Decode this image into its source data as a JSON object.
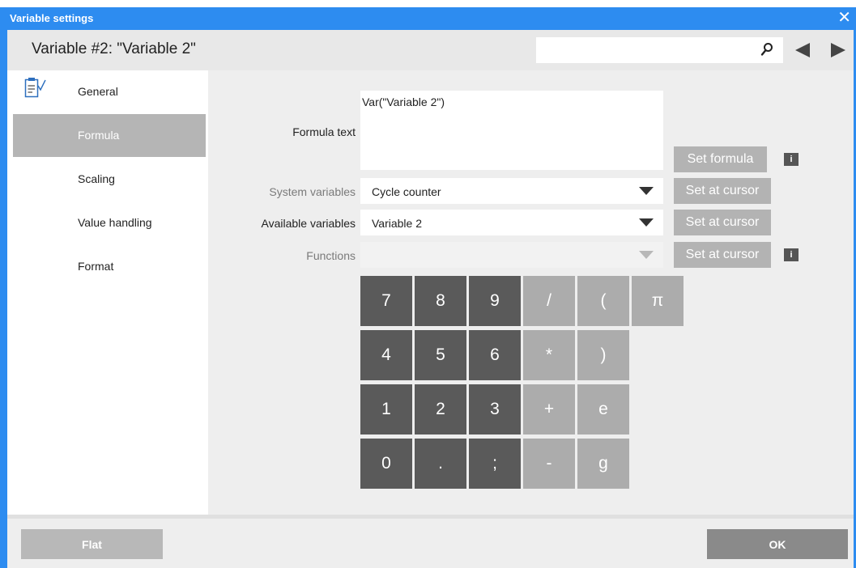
{
  "window": {
    "title": "Variable settings",
    "close_glyph": "✕"
  },
  "header": {
    "heading": "Variable #2: \"Variable 2\"",
    "search_value": "",
    "icons": [
      "search-icon",
      "arrow-left-icon",
      "arrow-right-icon"
    ]
  },
  "sidebar": {
    "items": [
      {
        "label": "General",
        "icon": "clipboard-check-icon"
      },
      {
        "label": "Formula",
        "active": true
      },
      {
        "label": "Scaling"
      },
      {
        "label": "Value handling"
      },
      {
        "label": "Format"
      }
    ]
  },
  "form": {
    "formula_label": "Formula text",
    "formula_value": "Var(\"Variable 2\")",
    "set_formula": "Set formula",
    "system_variables_label": "System variables",
    "system_variables_value": "Cycle counter",
    "available_variables_label": "Available variables",
    "available_variables_value": "Variable 2",
    "functions_label": "Functions",
    "functions_value": "",
    "set_at_cursor": "Set at cursor",
    "info_glyph": "i"
  },
  "keypad": {
    "keys": [
      "7",
      "8",
      "9",
      "/",
      "(",
      "π",
      "4",
      "5",
      "6",
      "*",
      ")",
      "1",
      "2",
      "3",
      "+",
      "e",
      "0",
      ".",
      ";",
      "-",
      "g"
    ]
  },
  "footer": {
    "flat": "Flat",
    "ok": "OK"
  },
  "colors": {
    "accent": "#2d8cf0",
    "active_item": "#b5b5b5",
    "key_dark": "#5a5a5a",
    "key_light": "#acacac",
    "button_gray": "#b3b3b3",
    "ok_button": "#8a8a8a"
  }
}
